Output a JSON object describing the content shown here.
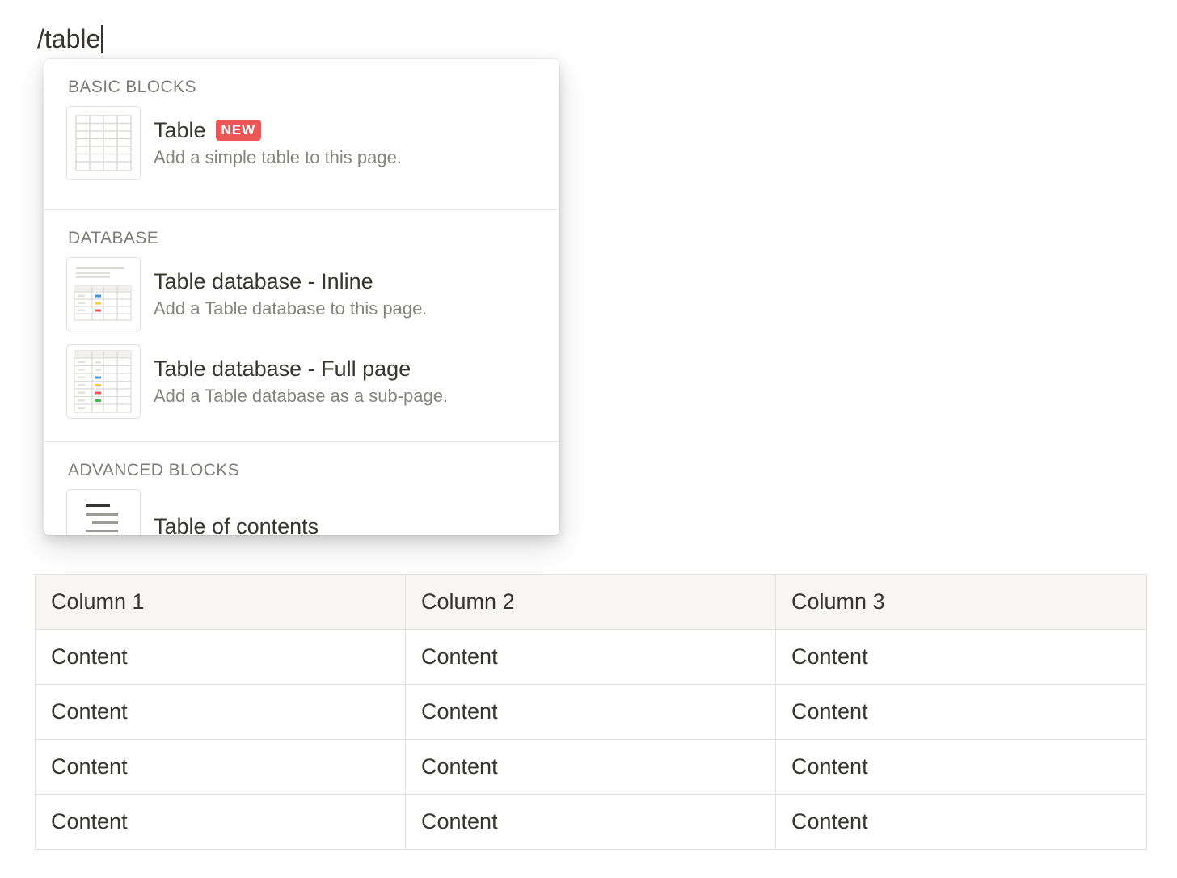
{
  "editor": {
    "command_text": "/table"
  },
  "menu": {
    "sections": [
      {
        "header": "BASIC BLOCKS",
        "items": [
          {
            "title": "Table",
            "badge": "NEW",
            "description": "Add a simple table to this page.",
            "icon": "simple-table-icon"
          }
        ]
      },
      {
        "header": "DATABASE",
        "items": [
          {
            "title": "Table database - Inline",
            "description": "Add a Table database to this page.",
            "icon": "inline-database-icon"
          },
          {
            "title": "Table database - Full page",
            "description": "Add a Table database as a sub-page.",
            "icon": "full-page-database-icon"
          }
        ]
      },
      {
        "header": "ADVANCED BLOCKS",
        "items": [
          {
            "title": "Table of contents",
            "icon": "table-of-contents-icon"
          }
        ]
      }
    ]
  },
  "table": {
    "headers": [
      "Column 1",
      "Column 2",
      "Column 3"
    ],
    "rows": [
      [
        "Content",
        "Content",
        "Content"
      ],
      [
        "Content",
        "Content",
        "Content"
      ],
      [
        "Content",
        "Content",
        "Content"
      ],
      [
        "Content",
        "Content",
        "Content"
      ]
    ]
  },
  "colors": {
    "text": "#37352f",
    "muted": "#86857f",
    "badge_bg": "#eb5757",
    "header_bg": "#f7f6f3",
    "border": "#e3e2df",
    "tag_blue": "#4a90d9",
    "tag_yellow": "#f2c94c",
    "tag_red": "#eb5757",
    "tag_green": "#4caf50"
  }
}
